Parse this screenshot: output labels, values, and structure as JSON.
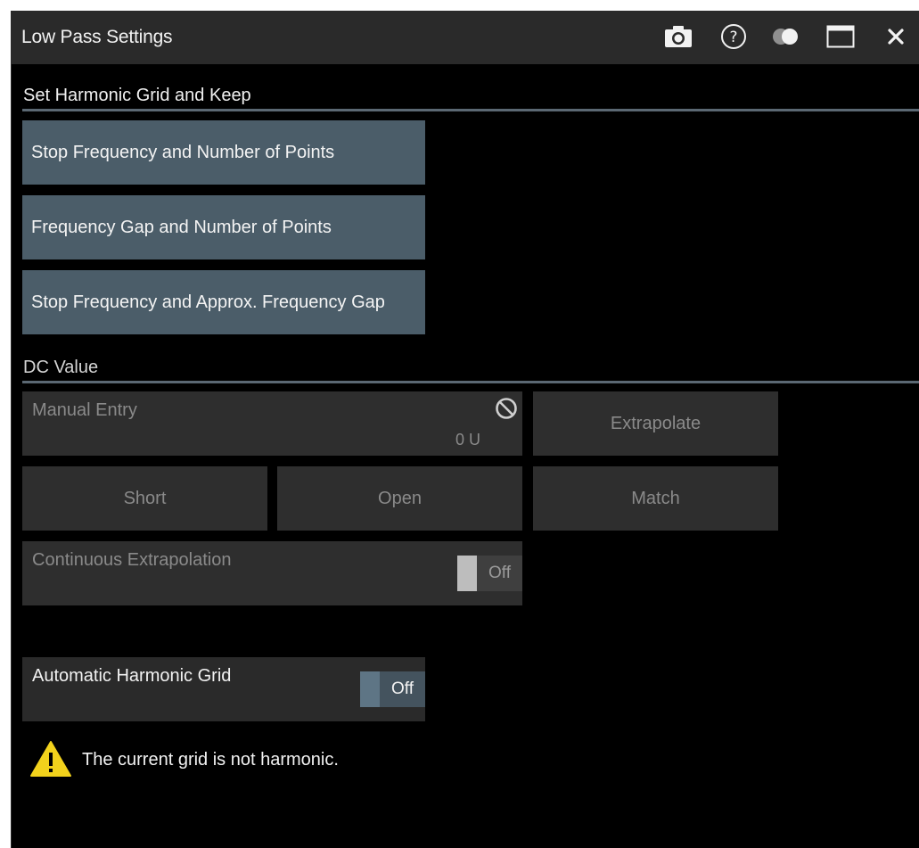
{
  "window": {
    "title": "Low Pass Settings"
  },
  "titlebar_icons": [
    "camera-icon",
    "help-icon",
    "toggle-display-icon",
    "maximize-icon",
    "close-icon"
  ],
  "harmonic_grid": {
    "section_label": "Set Harmonic Grid and Keep",
    "buttons": [
      "Stop Frequency and Number of Points",
      "Frequency Gap and Number of Points",
      "Stop Frequency and Approx. Frequency Gap"
    ]
  },
  "dc_value": {
    "section_label": "DC Value",
    "manual_entry_label": "Manual Entry",
    "manual_entry_value": "0 U",
    "extrapolate_label": "Extrapolate",
    "short_label": "Short",
    "open_label": "Open",
    "match_label": "Match",
    "continuous_extrapolation_label": "Continuous Extrapolation",
    "continuous_extrapolation_state": "Off"
  },
  "automatic_harmonic_grid": {
    "label": "Automatic Harmonic Grid",
    "state": "Off"
  },
  "warning": {
    "text": "The current grid is not harmonic."
  },
  "colors": {
    "accent_button": "#4b5d69",
    "disabled_button": "#2e2e2e",
    "titlebar": "#2a2a2a",
    "section_rule": "#5b6873",
    "warning_yellow": "#f2d21c"
  }
}
